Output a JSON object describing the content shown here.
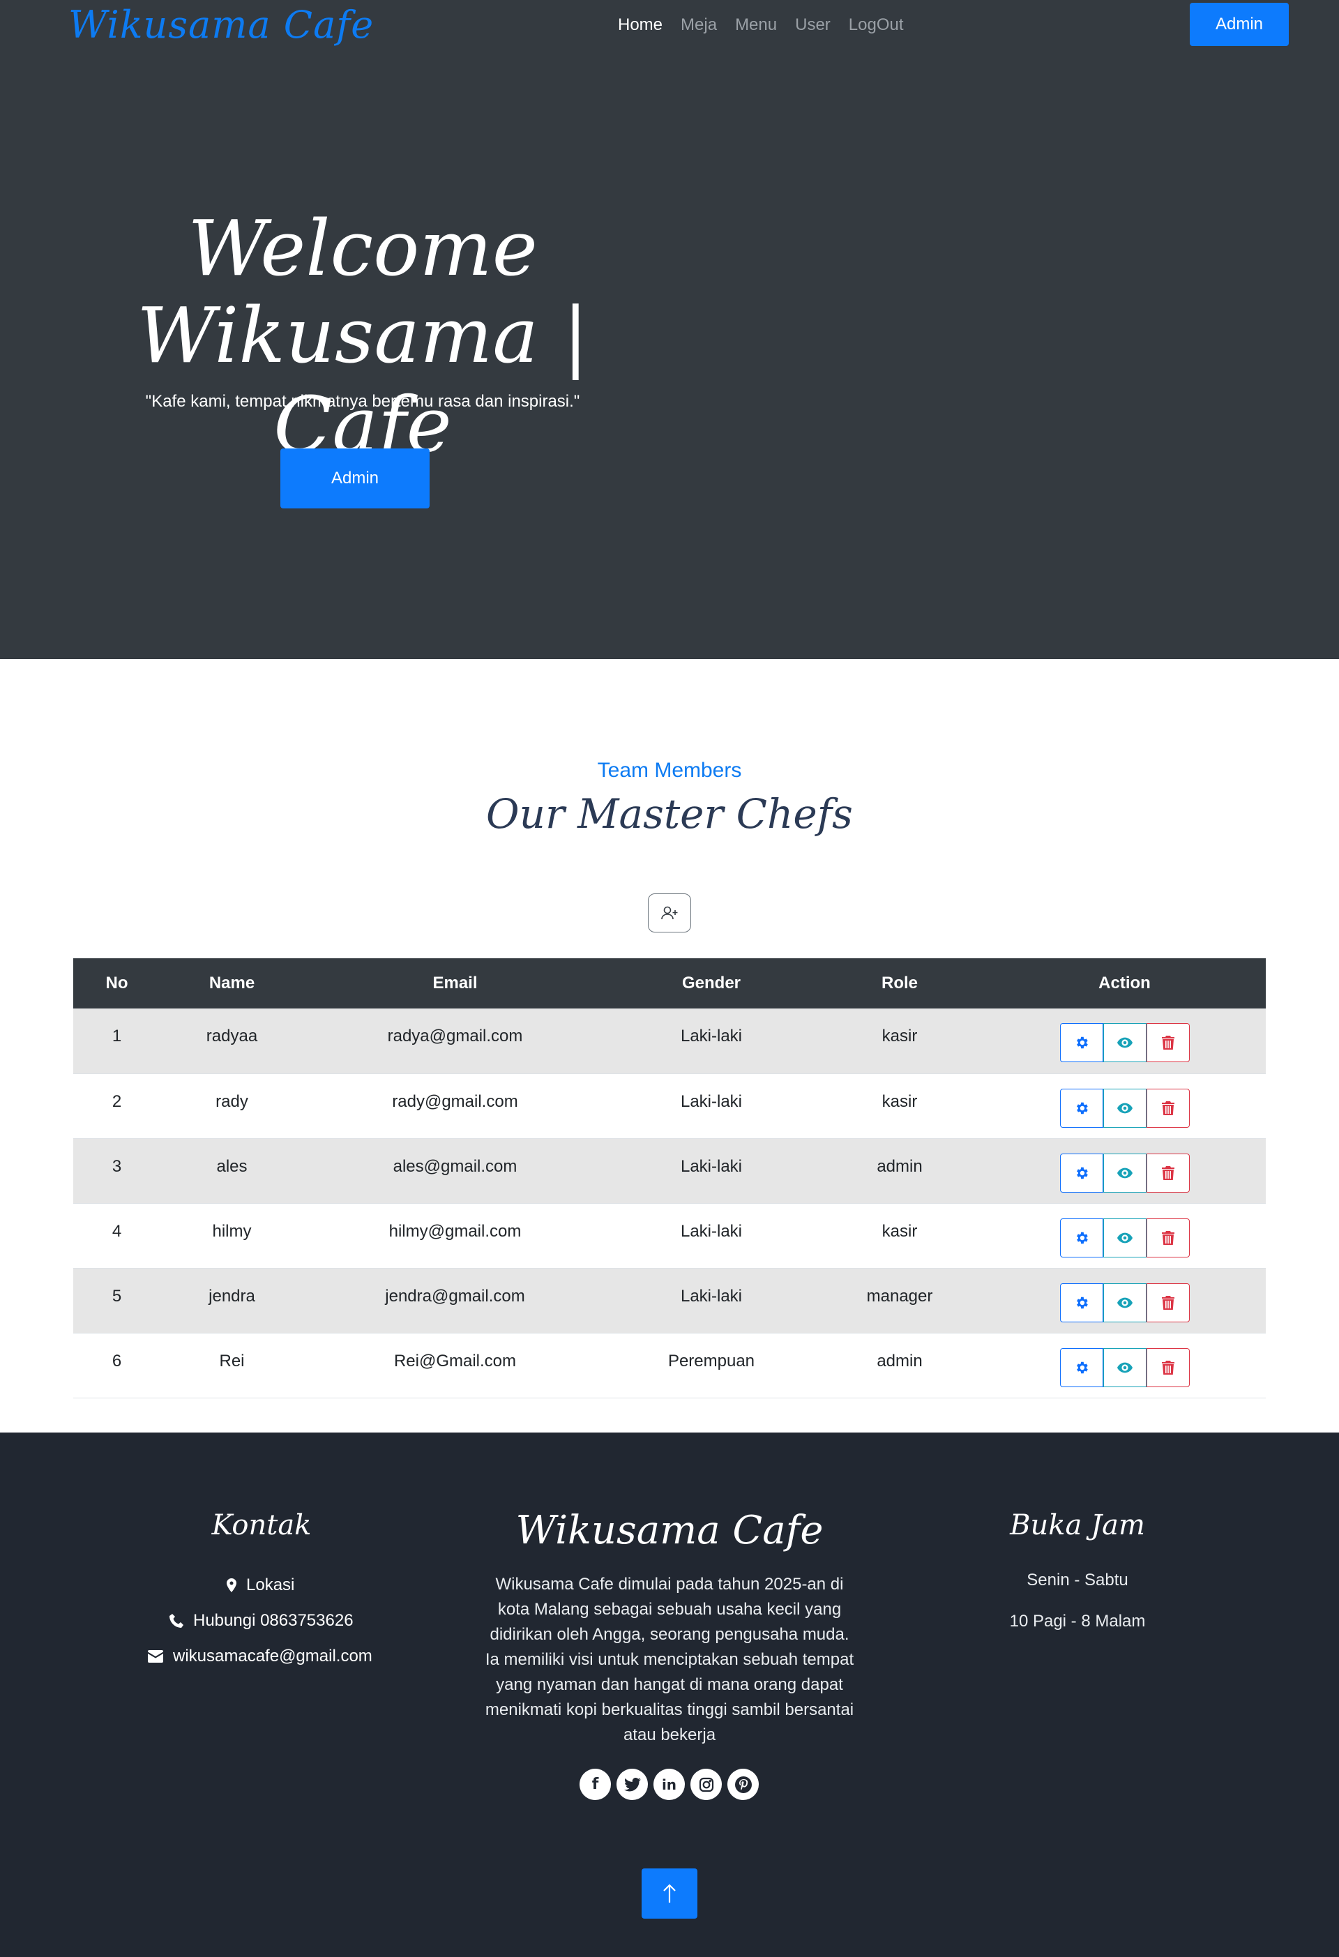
{
  "navbar": {
    "brand": "Wikusama Cafe",
    "links": [
      "Home",
      "Meja",
      "Menu",
      "User",
      "LogOut"
    ],
    "admin_button": "Admin"
  },
  "hero": {
    "title_line1": "Welcome",
    "title_line2": "Wikusama | Cafe",
    "quote": "\"Kafe kami, tempat nikmatnya bertemu rasa dan inspirasi.\"",
    "button": "Admin"
  },
  "team": {
    "subtitle": "Team Members",
    "title": "Our Master Chefs",
    "columns": [
      "No",
      "Name",
      "Email",
      "Gender",
      "Role",
      "Action"
    ],
    "rows": [
      {
        "no": "1",
        "name": "radyaa",
        "email": "radya@gmail.com",
        "gender": "Laki-laki",
        "role": "kasir"
      },
      {
        "no": "2",
        "name": "rady",
        "email": "rady@gmail.com",
        "gender": "Laki-laki",
        "role": "kasir"
      },
      {
        "no": "3",
        "name": "ales",
        "email": "ales@gmail.com",
        "gender": "Laki-laki",
        "role": "admin"
      },
      {
        "no": "4",
        "name": "hilmy",
        "email": "hilmy@gmail.com",
        "gender": "Laki-laki",
        "role": "kasir"
      },
      {
        "no": "5",
        "name": "jendra",
        "email": "jendra@gmail.com",
        "gender": "Laki-laki",
        "role": "manager"
      },
      {
        "no": "6",
        "name": "Rei",
        "email": "Rei@Gmail.com",
        "gender": "Perempuan",
        "role": "admin"
      }
    ]
  },
  "footer": {
    "contact_title": "Kontak",
    "location": "Lokasi",
    "phone": "Hubungi 0863753626",
    "email": "wikusamacafe@gmail.com",
    "brand_title": "Wikusama Cafe",
    "description_lines": [
      "Wikusama Cafe dimulai pada tahun 2025-an di",
      "kota Malang sebagai sebuah usaha kecil yang",
      "didirikan oleh Angga, seorang pengusaha muda.",
      "Ia memiliki visi untuk menciptakan sebuah tempat",
      "yang nyaman dan hangat di mana orang dapat",
      "menikmati kopi berkualitas tinggi sambil bersantai",
      "atau bekerja"
    ],
    "hours_title": "Buka Jam",
    "days": "Senin - Sabtu",
    "hours": "10 Pagi - 8 Malam",
    "socials": [
      "facebook-icon",
      "twitter-icon",
      "linkedin-icon",
      "instagram-icon",
      "pinterest-icon"
    ]
  },
  "colors": {
    "primary": "#0d7bfd",
    "dark": "#343a40",
    "footer_bg": "#212731",
    "info": "#17a2b8",
    "danger": "#dc3545"
  }
}
